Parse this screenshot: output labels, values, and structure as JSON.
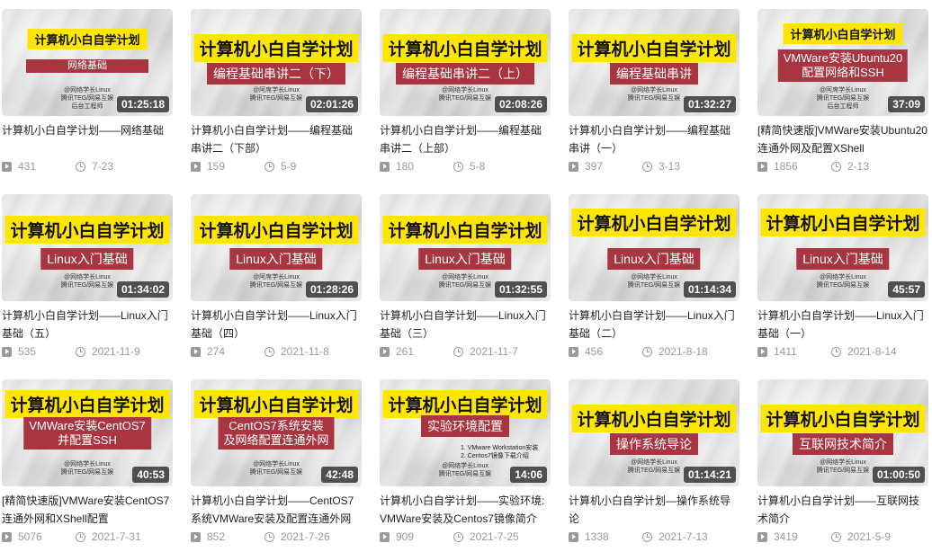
{
  "videos": [
    {
      "thumb_title": "计算机小白自学计划",
      "thumb_sub": [
        "网络基础"
      ],
      "thumb_note": [
        "@网络学长Linux",
        "腾讯TEG/网易互娱",
        "后台工程师"
      ],
      "duration": "01:25:18",
      "title": "计算机小白自学计划——网络基础",
      "views": "431",
      "date": "7-23"
    },
    {
      "thumb_title": "计算机小白自学计划",
      "thumb_sub": [
        "编程基础串讲二（下）"
      ],
      "thumb_note": [
        "@阿席学长Linux",
        "腾讯TEG/网易互娱"
      ],
      "duration": "02:01:26",
      "title": "计算机小白自学计划——编程基础串讲二（下部）",
      "views": "159",
      "date": "5-9"
    },
    {
      "thumb_title": "计算机小白自学计划",
      "thumb_sub": [
        "编程基础串讲二（上）"
      ],
      "thumb_note": [
        "@网络学长Linux",
        "腾讯TEG/网易互娱"
      ],
      "duration": "02:08:26",
      "title": "计算机小白自学计划——编程基础串讲二（上部）",
      "views": "180",
      "date": "5-8"
    },
    {
      "thumb_title": "计算机小白自学计划",
      "thumb_sub": [
        "编程基础串讲"
      ],
      "thumb_note": [
        "@网络学长Linux",
        "腾讯TEG/网易互娱"
      ],
      "duration": "01:32:27",
      "title": "计算机小白自学计划——编程基础串讲（一）",
      "views": "397",
      "date": "3-13"
    },
    {
      "thumb_title": "计算机小白自学计划",
      "thumb_sub": [
        "VMWare安装Ubuntu20",
        "配置网络和SSH"
      ],
      "thumb_note": [
        "@阿席学长Linux",
        "腾讯TEG/网易互娱",
        "后台工程师"
      ],
      "duration": "37:09",
      "title": "[精简快速版]VMWare安装Ubuntu20连通外网及配置XShell",
      "views": "1856",
      "date": "2-13"
    },
    {
      "thumb_title": "计算机小白自学计划",
      "thumb_sub": [
        "Linux入门基础"
      ],
      "thumb_note": [
        "@网络学长Linux",
        "腾讯TEG/网易互娱"
      ],
      "duration": "01:34:02",
      "title": "计算机小白自学计划——Linux入门基础（五）",
      "views": "535",
      "date": "2021-11-9"
    },
    {
      "thumb_title": "计算机小白自学计划",
      "thumb_sub": [
        "Linux入门基础"
      ],
      "thumb_note": [
        "@阿席学长Linux",
        "腾讯TEG/网易互娱"
      ],
      "duration": "01:28:26",
      "title": "计算机小白自学计划——Linux入门基础（四）",
      "views": "274",
      "date": "2021-11-8"
    },
    {
      "thumb_title": "计算机小白自学计划",
      "thumb_sub": [
        "Linux入门基础"
      ],
      "thumb_note": [
        "@网络学长Linux",
        "腾讯TEG/网易互娱"
      ],
      "duration": "01:32:55",
      "title": "计算机小白自学计划——Linux入门基础（三）",
      "views": "261",
      "date": "2021-11-7"
    },
    {
      "thumb_title": "计算机小白自学计划",
      "thumb_sub": [
        "Linux入门基础"
      ],
      "thumb_note": [
        "@网络学长Linux",
        "腾讯TEG/网易互娱"
      ],
      "duration": "01:14:34",
      "title": "计算机小白自学计划——Linux入门基础（二）",
      "views": "456",
      "date": "2021-8-18"
    },
    {
      "thumb_title": "计算机小白自学计划",
      "thumb_sub": [
        "Linux入门基础"
      ],
      "thumb_note": [
        "@网络学长Linux",
        "腾讯TEG/网易互娱"
      ],
      "duration": "45:57",
      "title": "计算机小白自学计划——Linux入门基础（一）",
      "views": "1411",
      "date": "2021-8-14"
    },
    {
      "thumb_title": "计算机小白自学计划",
      "thumb_sub": [
        "VMWare安装CentOS7",
        "并配置SSH"
      ],
      "thumb_note": [
        "@网络学长Linux",
        "腾讯TEG/网易互娱"
      ],
      "duration": "40:53",
      "title": "[精简快速版]VMWare安装CentOS7连通外网和XShell配置",
      "views": "5076",
      "date": "2021-7-31"
    },
    {
      "thumb_title": "计算机小白自学计划",
      "thumb_sub": [
        "CentOS7系统安装",
        "及网络配置连通外网"
      ],
      "thumb_note": [
        "@网络学长Linux",
        "腾讯TEG/网易互娱"
      ],
      "duration": "42:48",
      "title": "计算机小白自学计划——CentOS7系统VMWare安装及配置连通外网",
      "views": "852",
      "date": "2021-7-26"
    },
    {
      "thumb_title": "计算机小白自学计划",
      "thumb_sub": [
        "实验环境配置"
      ],
      "thumb_list": [
        "1. VMware Workstation安装",
        "2. Centos7镜像下载介绍"
      ],
      "thumb_note": [
        "@网络学长Linux",
        "腾讯TEG/网易互娱"
      ],
      "duration": "14:06",
      "title": "计算机小白自学计划——实验环境:VMWare安装及Centos7镜像简介",
      "views": "909",
      "date": "2021-7-25"
    },
    {
      "thumb_title": "计算机小白自学计划",
      "thumb_sub": [
        "操作系统导论"
      ],
      "thumb_note": [
        "@网络学长Linux",
        "腾讯TEG/网易互娱"
      ],
      "duration": "01:14:21",
      "title": "计算机小白自学计划—操作系统导论",
      "views": "1338",
      "date": "2021-7-13"
    },
    {
      "thumb_title": "计算机小白自学计划",
      "thumb_sub": [
        "互联网技术简介"
      ],
      "thumb_note": [
        "@网络学长Linux",
        "腾讯TEG/网易互娱"
      ],
      "duration": "01:00:50",
      "title": "计算机小白自学计划——互联网技术简介",
      "views": "3419",
      "date": "2021-5-9"
    }
  ]
}
